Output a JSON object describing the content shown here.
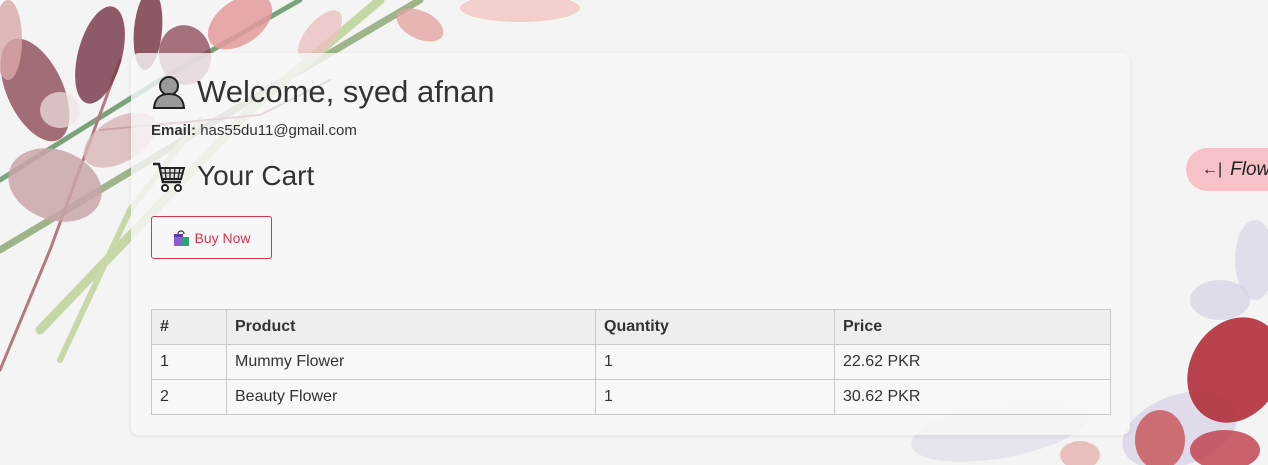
{
  "header": {
    "welcome_text": "Welcome, syed afnan",
    "email_label": "Email:",
    "email_value": "has55du11@gmail.com"
  },
  "cart": {
    "title": "Your Cart",
    "buy_button_label": "Buy Now"
  },
  "table": {
    "headers": [
      "#",
      "Product",
      "Quantity",
      "Price"
    ],
    "rows": [
      {
        "num": "1",
        "product": "Mummy Flower",
        "quantity": "1",
        "price": "22.62 PKR"
      },
      {
        "num": "2",
        "product": "Beauty Flower",
        "quantity": "1",
        "price": "30.62 PKR"
      }
    ]
  },
  "side_button": {
    "arrow": "←|",
    "label": "Flow"
  },
  "icons": {
    "user": "user-avatar-icon",
    "cart": "shopping-cart-icon",
    "bag": "shopping-bag-icon"
  },
  "colors": {
    "accent": "#d4364d",
    "side_button_bg": "#f7c1c8"
  }
}
